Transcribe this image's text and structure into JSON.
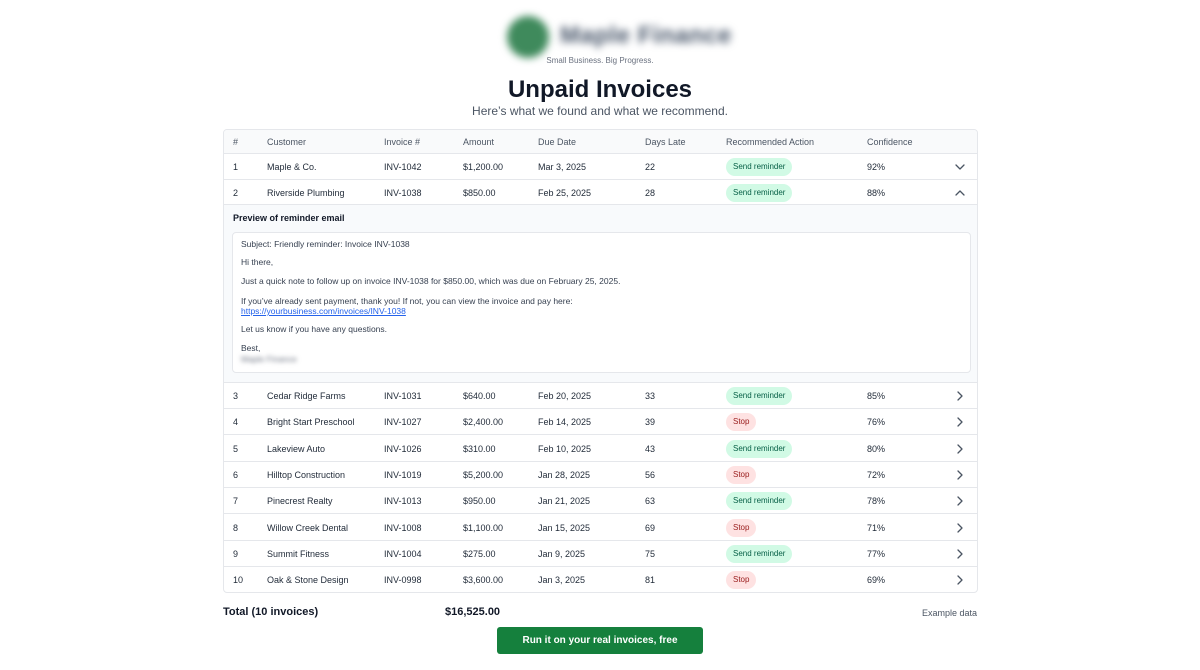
{
  "brand": {
    "name": "Maple Finance",
    "tagline": "Small Business. Big Progress."
  },
  "header": {
    "title": "Unpaid Invoices",
    "subtitle": "Here’s what we found and what we recommend."
  },
  "table": {
    "columns": [
      "#",
      "Customer",
      "Invoice #",
      "Amount",
      "Due Date",
      "Days Late",
      "Recommended Action",
      "Confidence"
    ],
    "rows": [
      {
        "num": "1",
        "customer": "Maple & Co.",
        "invoice": "INV-1042",
        "amount": "$1,200.00",
        "due": "Mar 3, 2025",
        "days_late": "22",
        "action": "Send reminder",
        "action_type": "send",
        "confidence": "92%",
        "expand_icon": "chevron-down-icon"
      },
      {
        "num": "2",
        "customer": "Riverside Plumbing",
        "invoice": "INV-1038",
        "amount": "$850.00",
        "due": "Feb 25, 2025",
        "days_late": "28",
        "action": "Send reminder",
        "action_type": "send",
        "confidence": "88%",
        "expand_icon": "chevron-up-icon"
      },
      {
        "num": "3",
        "customer": "Cedar Ridge Farms",
        "invoice": "INV-1031",
        "amount": "$640.00",
        "due": "Feb 20, 2025",
        "days_late": "33",
        "action": "Send reminder",
        "action_type": "send",
        "confidence": "85%",
        "expand_icon": "chevron-right-icon"
      },
      {
        "num": "4",
        "customer": "Bright Start Preschool",
        "invoice": "INV-1027",
        "amount": "$2,400.00",
        "due": "Feb 14, 2025",
        "days_late": "39",
        "action": "Stop",
        "action_type": "stop",
        "confidence": "76%",
        "expand_icon": "chevron-right-icon"
      },
      {
        "num": "5",
        "customer": "Lakeview Auto",
        "invoice": "INV-1026",
        "amount": "$310.00",
        "due": "Feb 10, 2025",
        "days_late": "43",
        "action": "Send reminder",
        "action_type": "send",
        "confidence": "80%",
        "expand_icon": "chevron-right-icon"
      },
      {
        "num": "6",
        "customer": "Hilltop Construction",
        "invoice": "INV-1019",
        "amount": "$5,200.00",
        "due": "Jan 28, 2025",
        "days_late": "56",
        "action": "Stop",
        "action_type": "stop",
        "confidence": "72%",
        "expand_icon": "chevron-right-icon"
      },
      {
        "num": "7",
        "customer": "Pinecrest Realty",
        "invoice": "INV-1013",
        "amount": "$950.00",
        "due": "Jan 21, 2025",
        "days_late": "63",
        "action": "Send reminder",
        "action_type": "send",
        "confidence": "78%",
        "expand_icon": "chevron-right-icon"
      },
      {
        "num": "8",
        "customer": "Willow Creek Dental",
        "invoice": "INV-1008",
        "amount": "$1,100.00",
        "due": "Jan 15, 2025",
        "days_late": "69",
        "action": "Stop",
        "action_type": "stop",
        "confidence": "71%",
        "expand_icon": "chevron-right-icon"
      },
      {
        "num": "9",
        "customer": "Summit Fitness",
        "invoice": "INV-1004",
        "amount": "$275.00",
        "due": "Jan 9, 2025",
        "days_late": "75",
        "action": "Send reminder",
        "action_type": "send",
        "confidence": "77%",
        "expand_icon": "chevron-right-icon"
      },
      {
        "num": "10",
        "customer": "Oak & Stone Design",
        "invoice": "INV-0998",
        "amount": "$3,600.00",
        "due": "Jan 3, 2025",
        "days_late": "81",
        "action": "Stop",
        "action_type": "stop",
        "confidence": "69%",
        "expand_icon": "chevron-right-icon"
      }
    ]
  },
  "preview": {
    "title": "Preview of reminder email",
    "subject": "Subject: Friendly reminder: Invoice INV-1038",
    "greeting": "Hi there,",
    "body1": "Just a quick note to follow up on invoice INV-1038 for $850.00, which was due on February 25, 2025.",
    "body2": "If you’ve already sent payment, thank you! If not, you can view the invoice and pay here:",
    "link": "https://yourbusiness.com/invoices/INV-1038",
    "body3": "Let us know if you have any questions.",
    "signoff": "Best,",
    "signature": "Maple Finance"
  },
  "footer": {
    "total_label": "Total (10 invoices)",
    "total_value": "$16,525.00",
    "example_label": "Example data",
    "cta_label": "Run it on your real invoices, free"
  },
  "colors": {
    "accent": "#15803d",
    "send_bg": "#d1fae5",
    "stop_bg": "#fee2e2",
    "link": "#2563eb"
  }
}
